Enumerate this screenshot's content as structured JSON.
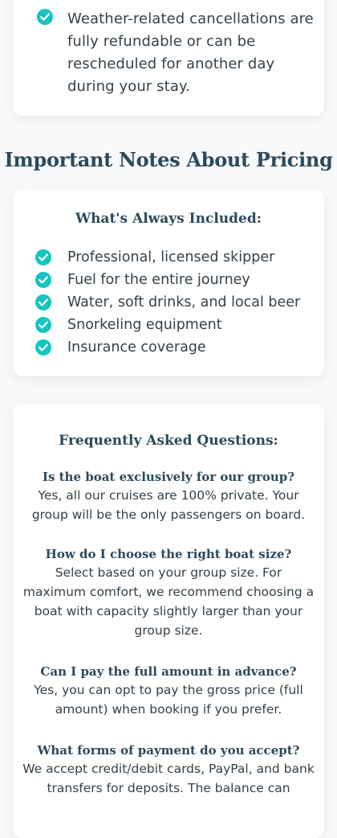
{
  "refund_card": {
    "text": "Weather-related cancellations are fully refundable or can be rescheduled for another day during your stay."
  },
  "pricing": {
    "title": "Important Notes About Pricing",
    "included": {
      "heading": "What's Always Included:",
      "items": [
        "Professional, licensed skipper",
        "Fuel for the entire journey",
        "Water, soft drinks, and local beer",
        "Snorkeling equipment",
        "Insurance coverage"
      ]
    }
  },
  "faq": {
    "heading": "Frequently Asked Questions:",
    "items": [
      {
        "q": "Is the boat exclusively for our group?",
        "a": "Yes, all our cruises are 100% private. Your group will be the only passengers on board."
      },
      {
        "q": "How do I choose the right boat size?",
        "a": "Select based on your group size. For maximum comfort, we recommend choosing a boat with capacity slightly larger than your group size."
      },
      {
        "q": "Can I pay the full amount in advance?",
        "a": "Yes, you can opt to pay the gross price (full amount) when booking if you prefer."
      },
      {
        "q": "What forms of payment do you accept?",
        "a": "We accept credit/debit cards, PayPal, and bank transfers for deposits. The balance can"
      }
    ]
  },
  "colors": {
    "accent": "#17c4c0",
    "heading": "#2c4a5c",
    "text": "#33414a"
  },
  "icons": {
    "check": "check-circle-icon"
  }
}
